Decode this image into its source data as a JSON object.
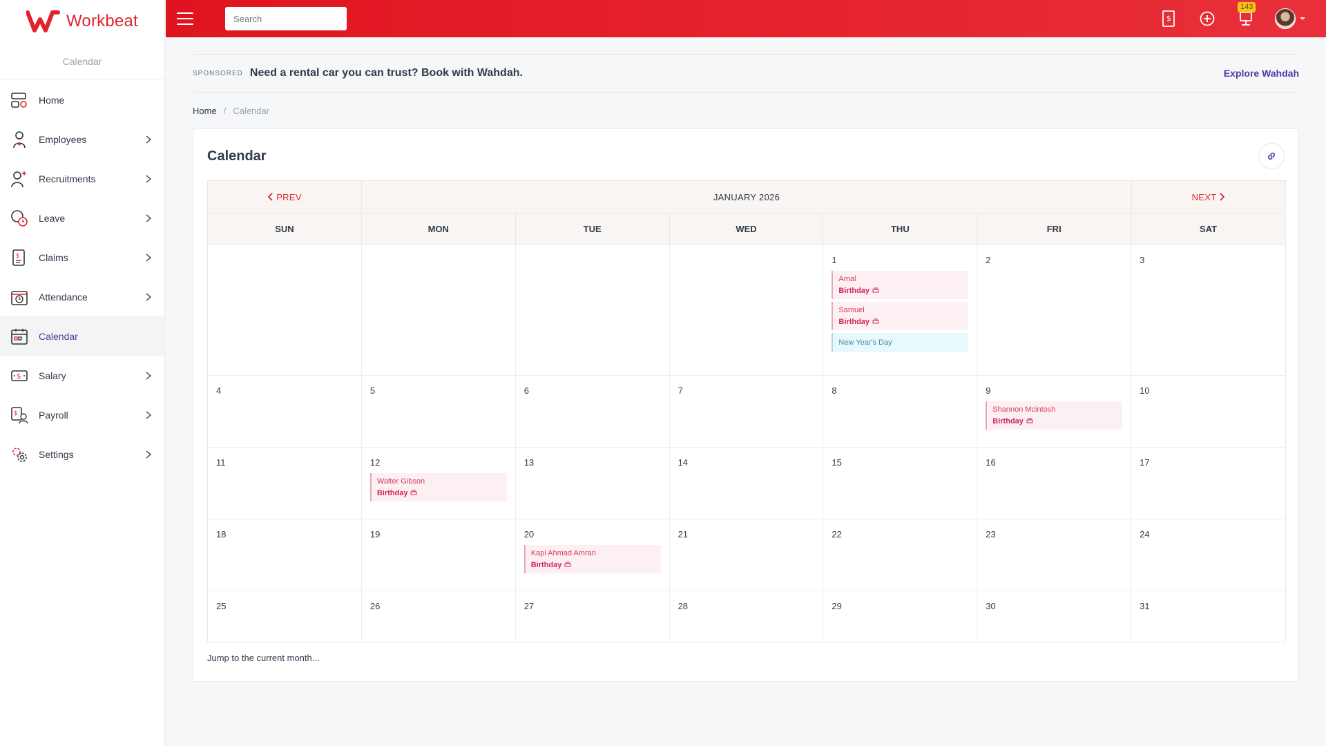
{
  "app": {
    "name": "Workbeat",
    "brand_color": "#e0232e",
    "accent_color": "#4a3aa0"
  },
  "sidebar": {
    "subtitle": "Calendar",
    "items": [
      {
        "label": "Home",
        "icon": "home-icon",
        "has_submenu": false
      },
      {
        "label": "Employees",
        "icon": "employees-icon",
        "has_submenu": true
      },
      {
        "label": "Recruitments",
        "icon": "recruitments-icon",
        "has_submenu": true
      },
      {
        "label": "Leave",
        "icon": "leave-icon",
        "has_submenu": true
      },
      {
        "label": "Claims",
        "icon": "claims-icon",
        "has_submenu": true
      },
      {
        "label": "Attendance",
        "icon": "attendance-icon",
        "has_submenu": true
      },
      {
        "label": "Calendar",
        "icon": "calendar-icon",
        "has_submenu": false,
        "active": true
      },
      {
        "label": "Salary",
        "icon": "salary-icon",
        "has_submenu": true
      },
      {
        "label": "Payroll",
        "icon": "payroll-icon",
        "has_submenu": true
      },
      {
        "label": "Settings",
        "icon": "settings-icon",
        "has_submenu": true
      }
    ]
  },
  "topbar": {
    "search_placeholder": "Search",
    "notification_count": "143",
    "icons": [
      "invoice-icon",
      "plus-circle-icon",
      "notification-icon",
      "avatar"
    ]
  },
  "sponsor": {
    "tag": "SPONSORED",
    "text": "Need a rental car you can trust? Book with Wahdah.",
    "link": "Explore Wahdah"
  },
  "breadcrumb": {
    "home": "Home",
    "separator": "/",
    "current": "Calendar"
  },
  "card": {
    "title": "Calendar"
  },
  "calendar": {
    "prev_label": "PREV",
    "next_label": "NEXT",
    "month_label": "JANUARY 2026",
    "days_of_week": [
      "SUN",
      "MON",
      "TUE",
      "WED",
      "THU",
      "FRI",
      "SAT"
    ],
    "weeks": [
      [
        {
          "day": ""
        },
        {
          "day": ""
        },
        {
          "day": ""
        },
        {
          "day": ""
        },
        {
          "day": "1",
          "events": [
            {
              "name": "Amal",
              "type": "Birthday",
              "kind": "birthday"
            },
            {
              "name": "Samuel",
              "type": "Birthday",
              "kind": "birthday"
            },
            {
              "name": "New Year's Day",
              "kind": "holiday"
            }
          ]
        },
        {
          "day": "2"
        },
        {
          "day": "3"
        }
      ],
      [
        {
          "day": "4"
        },
        {
          "day": "5"
        },
        {
          "day": "6"
        },
        {
          "day": "7"
        },
        {
          "day": "8"
        },
        {
          "day": "9",
          "events": [
            {
              "name": "Shannon Mcintosh",
              "type": "Birthday",
              "kind": "birthday"
            }
          ]
        },
        {
          "day": "10"
        }
      ],
      [
        {
          "day": "11"
        },
        {
          "day": "12",
          "events": [
            {
              "name": "Walter Gibson",
              "type": "Birthday",
              "kind": "birthday"
            }
          ]
        },
        {
          "day": "13"
        },
        {
          "day": "14"
        },
        {
          "day": "15"
        },
        {
          "day": "16"
        },
        {
          "day": "17"
        }
      ],
      [
        {
          "day": "18"
        },
        {
          "day": "19"
        },
        {
          "day": "20",
          "events": [
            {
              "name": "Kapi Ahmad Amran",
              "type": "Birthday",
              "kind": "birthday"
            }
          ]
        },
        {
          "day": "21"
        },
        {
          "day": "22"
        },
        {
          "day": "23"
        },
        {
          "day": "24"
        }
      ],
      [
        {
          "day": "25"
        },
        {
          "day": "26"
        },
        {
          "day": "27"
        },
        {
          "day": "28"
        },
        {
          "day": "29"
        },
        {
          "day": "30"
        },
        {
          "day": "31"
        }
      ]
    ],
    "jump_label": "Jump to the current month..."
  }
}
